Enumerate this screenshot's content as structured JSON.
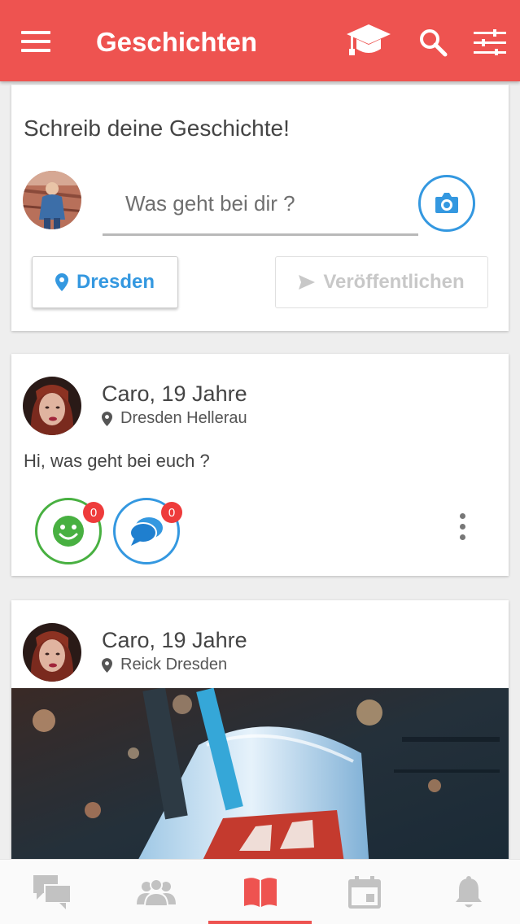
{
  "header": {
    "title": "Geschichten",
    "color": "#ee5350",
    "icons": [
      "menu-icon",
      "graduation-cap-icon",
      "search-icon",
      "filter-sliders-icon"
    ]
  },
  "compose": {
    "heading": "Schreib deine Geschichte!",
    "placeholder": "Was geht bei dir ?",
    "value": "",
    "location_label": "Dresden",
    "publish_label": "Veröffentlichen"
  },
  "posts": [
    {
      "name": "Caro, 19 Jahre",
      "location": "Dresden Hellerau",
      "text": "Hi, was geht bei euch ?",
      "likes": "0",
      "comments": "0"
    },
    {
      "name": "Caro, 19 Jahre",
      "location": "Reick Dresden",
      "text": ""
    }
  ],
  "bottom_nav": {
    "tabs": [
      "chat-icon",
      "people-icon",
      "book-icon",
      "calendar-icon",
      "bell-icon"
    ],
    "active_index": 2,
    "active_color": "#ee5350",
    "inactive_color": "#c2c2c2"
  }
}
